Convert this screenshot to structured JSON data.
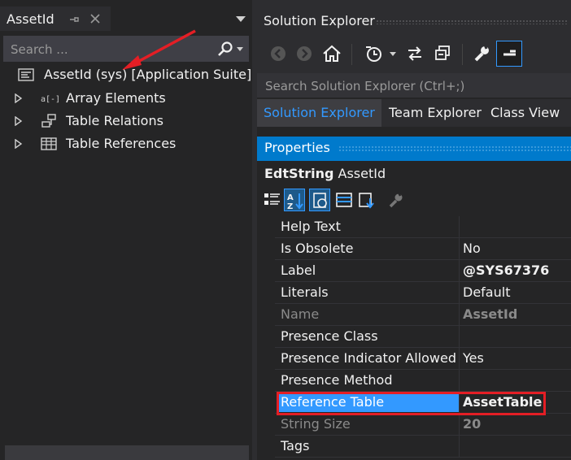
{
  "left_panel": {
    "tab_title": "AssetId",
    "search_placeholder": "Search ...",
    "root_item": "AssetId (sys) [Application Suite]",
    "children": [
      {
        "label": "Array Elements",
        "icon": "array-elements-icon"
      },
      {
        "label": "Table Relations",
        "icon": "table-relations-icon"
      },
      {
        "label": "Table References",
        "icon": "table-references-icon"
      }
    ]
  },
  "solution_explorer": {
    "title": "Solution Explorer",
    "search_placeholder": "Search Solution Explorer (Ctrl+;)",
    "tabs": [
      "Solution Explorer",
      "Team Explorer",
      "Class View"
    ],
    "active_tab": "Solution Explorer"
  },
  "properties": {
    "title": "Properties",
    "object_type": "EdtString",
    "object_name": "AssetId",
    "rows": [
      {
        "name": "Help Text",
        "value": ""
      },
      {
        "name": "Is Obsolete",
        "value": "No"
      },
      {
        "name": "Label",
        "value": "@SYS67376",
        "bold": true
      },
      {
        "name": "Literals",
        "value": "Default"
      },
      {
        "name": "Name",
        "value": "AssetId",
        "muted": true,
        "bold": true
      },
      {
        "name": "Presence Class",
        "value": ""
      },
      {
        "name": "Presence Indicator Allowed",
        "value": "Yes"
      },
      {
        "name": "Presence Method",
        "value": ""
      },
      {
        "name": "Reference Table",
        "value": "AssetTable",
        "bold": true,
        "selected": true
      },
      {
        "name": "String Size",
        "value": "20",
        "muted": true,
        "bold": true
      },
      {
        "name": "Tags",
        "value": ""
      }
    ]
  },
  "colors": {
    "accent": "#007acc",
    "selection": "#3399ff",
    "highlight_box": "#e41e25",
    "annotation_arrow": "#e41e25"
  }
}
